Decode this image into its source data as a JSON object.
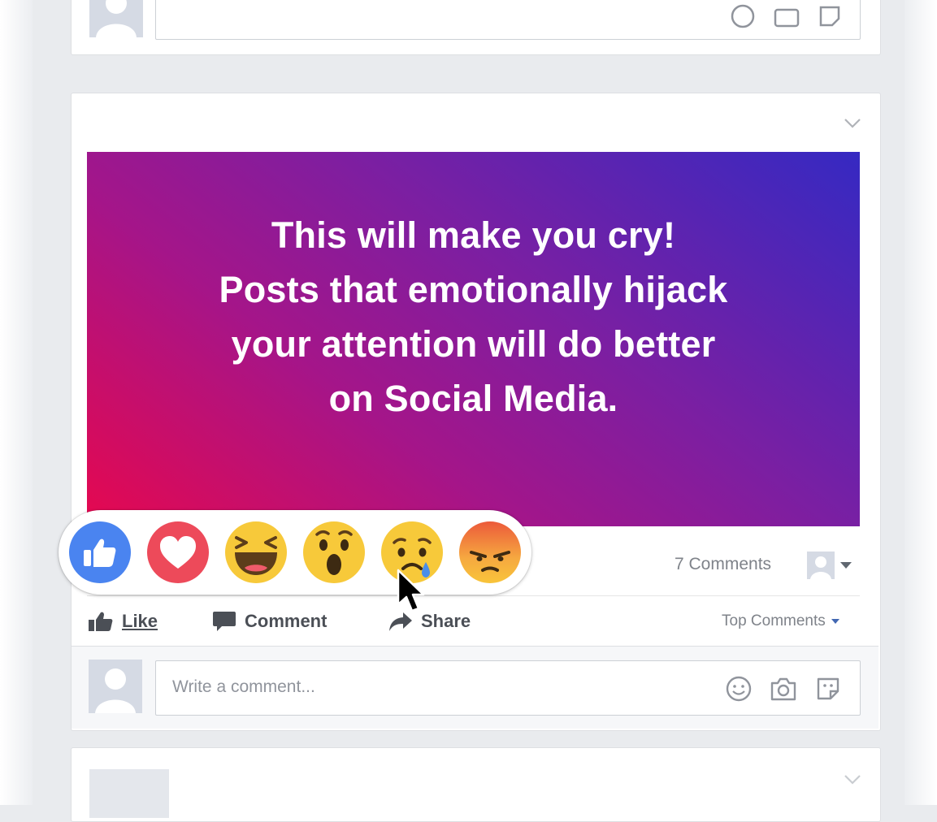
{
  "post": {
    "banner_lines": [
      "This will make you cry!",
      "Posts that emotionally hijack",
      "your attention will do better",
      "on Social Media."
    ],
    "comments_count": "7 Comments",
    "top_comments_label": "Top Comments"
  },
  "actions": {
    "like": "Like",
    "comment": "Comment",
    "share": "Share"
  },
  "reactions": [
    {
      "name": "like",
      "icon": "thumbs-up-icon",
      "color": "#4a84f0"
    },
    {
      "name": "love",
      "icon": "heart-icon",
      "color": "#ed4a5a"
    },
    {
      "name": "haha",
      "icon": "laughing-face-icon",
      "color": "#f7c93a"
    },
    {
      "name": "wow",
      "icon": "surprised-face-icon",
      "color": "#f7c93a"
    },
    {
      "name": "sad",
      "icon": "crying-face-icon",
      "color": "#f7c93a"
    },
    {
      "name": "angry",
      "icon": "angry-face-icon",
      "color": "#f08a35"
    }
  ],
  "comment_input": {
    "placeholder": "Write a comment..."
  }
}
